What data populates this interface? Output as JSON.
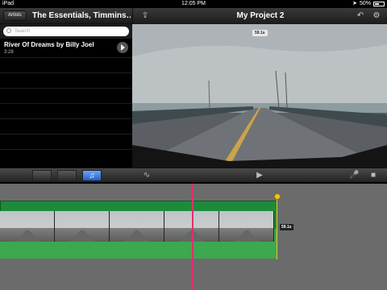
{
  "status_bar": {
    "device": "iPad",
    "time": "12:05 PM",
    "battery": "50%",
    "battery_level": 0.5
  },
  "library": {
    "back_button": "Artists",
    "title": "The Essentials, Timmins…",
    "search_placeholder": "Search",
    "songs": [
      {
        "title": "River Of Dreams by Billy Joel",
        "duration": "3:28"
      }
    ]
  },
  "project": {
    "title": "My Project 2",
    "preview_time": "59.1s"
  },
  "timeline": {
    "clip_duration": "59.1s"
  },
  "icons": {
    "share": "share-icon",
    "undo": "undo-icon",
    "settings": "gear-icon",
    "clip_browser": "film-icon",
    "photo_browser": "photos-icon",
    "music_browser": "music-note-icon",
    "audio_waveform": "waveform-icon",
    "play": "play-icon",
    "microphone": "microphone-icon",
    "camera": "camera-icon"
  },
  "colors": {
    "playhead": "#e0306c",
    "clip_green": "#1d8b3a",
    "end_marker": "#f4c325",
    "active_tab": "#2f6fd4"
  }
}
